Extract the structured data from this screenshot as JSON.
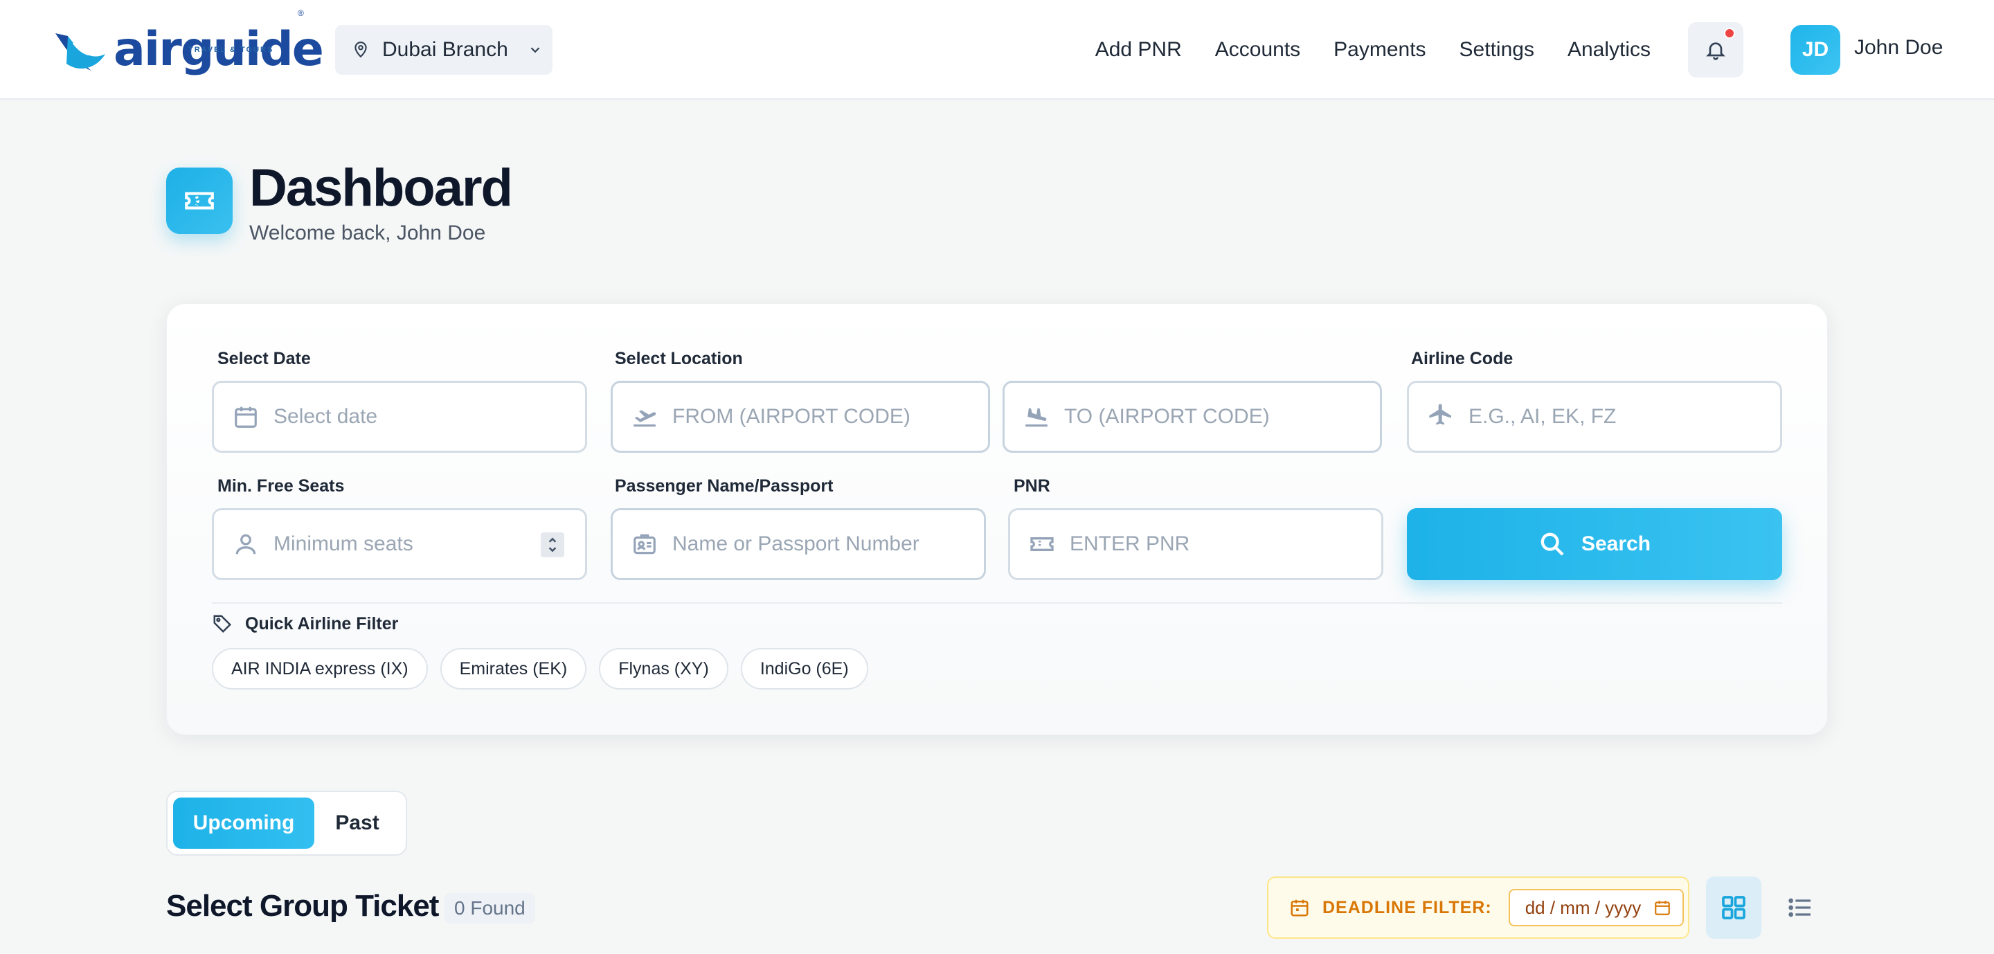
{
  "brand": {
    "name": "airguide",
    "tagline": "TRAVEL & TOURS",
    "registered": "®"
  },
  "branch": {
    "label": "Dubai Branch"
  },
  "nav": [
    "Add PNR",
    "Accounts",
    "Payments",
    "Settings",
    "Analytics"
  ],
  "user": {
    "initials": "JD",
    "name": "John Doe"
  },
  "page": {
    "title": "Dashboard",
    "subtitle": "Welcome back, John Doe"
  },
  "search_form": {
    "date": {
      "label": "Select Date",
      "placeholder": "Select date"
    },
    "location": {
      "label": "Select Location",
      "from_placeholder": "FROM (AIRPORT CODE)",
      "to_placeholder": "TO (AIRPORT CODE)"
    },
    "airline": {
      "label": "Airline Code",
      "placeholder": "E.G., AI, EK, FZ"
    },
    "seats": {
      "label": "Min. Free Seats",
      "placeholder": "Minimum seats"
    },
    "passenger": {
      "label": "Passenger Name/Passport",
      "placeholder": "Name or Passport Number"
    },
    "pnr": {
      "label": "PNR",
      "placeholder": "ENTER PNR"
    },
    "search_label": "Search"
  },
  "quick_filter": {
    "label": "Quick Airline Filter",
    "chips": [
      "AIR INDIA express (IX)",
      "Emirates (EK)",
      "Flynas (XY)",
      "IndiGo (6E)"
    ]
  },
  "tabs": {
    "upcoming": "Upcoming",
    "past": "Past",
    "active": "Upcoming"
  },
  "group_ticket": {
    "title": "Select Group Ticket",
    "count": "0 Found",
    "deadline_label": "DEADLINE FILTER:",
    "date_placeholder": "dd / mm / yyyy"
  },
  "colors": {
    "accent": "#1db2e8",
    "brand_navy": "#1c4a9e",
    "warning": "#d97706",
    "notification": "#ef4444"
  },
  "icons": [
    "logo-wing-icon",
    "map-pin-icon",
    "chevron-down-icon",
    "bell-icon",
    "ticket-icon",
    "calendar-icon",
    "plane-takeoff-icon",
    "plane-landing-icon",
    "plane-icon",
    "user-icon",
    "stepper-icon",
    "id-card-icon",
    "search-icon",
    "tag-icon",
    "grid-view-icon",
    "list-view-icon"
  ]
}
